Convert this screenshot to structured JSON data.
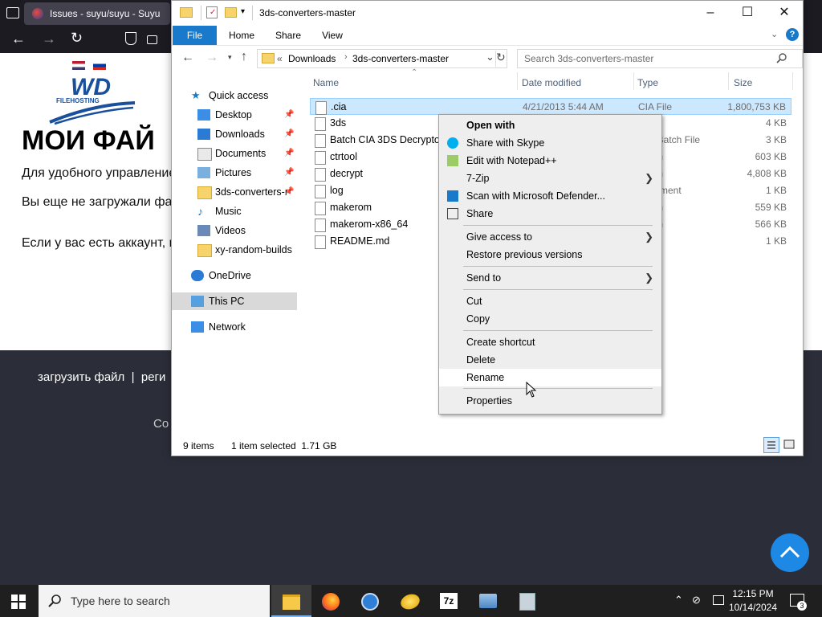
{
  "browser": {
    "tab_title": "Issues - suyu/suyu - Suyu",
    "logo_text": "WD",
    "logo_sub": "FILEHOSTING",
    "heading": "МОИ ФАЙ",
    "para1": "Для удобного управление",
    "para2": "Вы еще не загружали фа",
    "para3": "Если у вас есть аккаунт, н",
    "footer_links": "загрузить файл  |  реги",
    "footer_copy": "Co"
  },
  "explorer": {
    "window_title": "3ds-converters-master",
    "ribbon_tabs": [
      "File",
      "Home",
      "Share",
      "View"
    ],
    "breadcrumb_prefix": "«",
    "breadcrumb": [
      "Downloads",
      "3ds-converters-master"
    ],
    "search_placeholder": "Search 3ds-converters-master",
    "columns": {
      "name": "Name",
      "date": "Date modified",
      "type": "Type",
      "size": "Size"
    },
    "nav": [
      {
        "label": "Quick access",
        "icon": "star-icon"
      },
      {
        "label": "Desktop",
        "icon": "desktop-icon",
        "pinned": true
      },
      {
        "label": "Downloads",
        "icon": "download-icon",
        "pinned": true
      },
      {
        "label": "Documents",
        "icon": "documents-icon",
        "pinned": true
      },
      {
        "label": "Pictures",
        "icon": "pictures-icon",
        "pinned": true
      },
      {
        "label": "3ds-converters-r",
        "icon": "folder-icon",
        "pinned": true
      },
      {
        "label": "Music",
        "icon": "music-icon"
      },
      {
        "label": "Videos",
        "icon": "videos-icon"
      },
      {
        "label": "xy-random-builds",
        "icon": "folder-icon"
      },
      {
        "label": "OneDrive",
        "icon": "cloud-icon"
      },
      {
        "label": "This PC",
        "icon": "computer-icon"
      },
      {
        "label": "Network",
        "icon": "network-icon"
      }
    ],
    "files": [
      {
        "name": ".cia",
        "date": "4/21/2013 5:44 AM",
        "type": "CIA File",
        "size": "1,800,753 KB"
      },
      {
        "name": "3ds",
        "date": "",
        "type": "n File",
        "size": "4 KB"
      },
      {
        "name": "Batch CIA 3DS Decryptor",
        "date": "",
        "type": "ows Batch File",
        "size": "3 KB"
      },
      {
        "name": "ctrtool",
        "date": "",
        "type": "cation",
        "size": "603 KB"
      },
      {
        "name": "decrypt",
        "date": "",
        "type": "cation",
        "size": "4,808 KB"
      },
      {
        "name": "log",
        "date": "",
        "type": "Document",
        "size": "1 KB"
      },
      {
        "name": "makerom",
        "date": "",
        "type": "cation",
        "size": "559 KB"
      },
      {
        "name": "makerom-x86_64",
        "date": "",
        "type": "cation",
        "size": "566 KB"
      },
      {
        "name": "README.md",
        "date": "",
        "type": "le",
        "size": "1 KB"
      }
    ],
    "status": {
      "items": "9 items",
      "selected": "1 item selected  1.71 GB"
    }
  },
  "context_menu": {
    "items": [
      {
        "label": "Open with",
        "bold": true
      },
      {
        "label": "Share with Skype",
        "icon": "skype-icon"
      },
      {
        "label": "Edit with Notepad++",
        "icon": "notepad-icon"
      },
      {
        "label": "7-Zip",
        "submenu": true
      },
      {
        "label": "Scan with Microsoft Defender...",
        "icon": "defender-icon"
      },
      {
        "label": "Share",
        "icon": "share-icon"
      },
      {
        "label": "Give access to",
        "submenu": true
      },
      {
        "label": "Restore previous versions"
      },
      {
        "label": "Send to",
        "submenu": true
      },
      {
        "label": "Cut"
      },
      {
        "label": "Copy"
      },
      {
        "label": "Create shortcut"
      },
      {
        "label": "Delete"
      },
      {
        "label": "Rename",
        "hovered": true
      },
      {
        "label": "Properties"
      }
    ]
  },
  "taskbar": {
    "search_placeholder": "Type here to search",
    "time": "12:15 PM",
    "date": "10/14/2024",
    "notification_count": "3",
    "zip_label": "7z"
  }
}
